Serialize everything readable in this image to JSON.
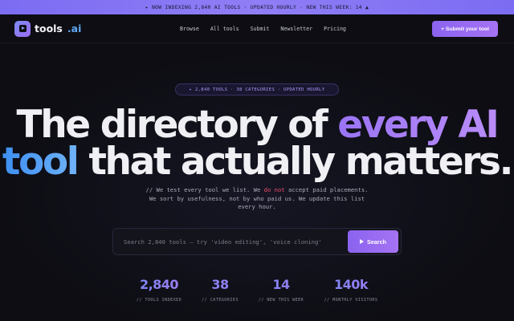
{
  "ticker": {
    "text": "▸ NOW INDEXING 2,840 AI TOOLS · UPDATED HOURLY · NEW THIS WEEK: 14 ▲"
  },
  "logo": {
    "name": "tools",
    "suffix": ".ai"
  },
  "nav": {
    "links": [
      "Browse",
      "All tools",
      "Submit",
      "Newsletter",
      "Pricing"
    ],
    "submit_label": "+ Submit your tool"
  },
  "hero": {
    "pill": "▸ 2,840 TOOLS · 38 CATEGORIES · UPDATED HOURLY",
    "headline_line1_plain": "The directory of ",
    "headline_line1_accent": "every AI",
    "headline_line2_accent": "tool",
    "headline_line2_plain": " that actually matters.",
    "sub_before": "// We test every tool we list. We ",
    "sub_emphasis": "do not",
    "sub_after": " accept paid placements. We sort by usefulness, not by who paid us. We update this list every hour."
  },
  "search": {
    "placeholder": "Search 2,840 tools — try 'video editing', 'voice cloning'",
    "button_label": "Search"
  },
  "stats": [
    {
      "value": "2,840",
      "label": "// TOOLS INDEXED"
    },
    {
      "value": "38",
      "label": "// CATEGORIES"
    },
    {
      "value": "14",
      "label": "// NEW THIS WEEK"
    },
    {
      "value": "140k",
      "label": "// MONTHLY VISITORS"
    }
  ],
  "colors": {
    "accent_purple": "#9a74f5",
    "accent_blue": "#4a95f3",
    "background": "#0d0d13",
    "emphasis_red": "#ee4f6a"
  }
}
